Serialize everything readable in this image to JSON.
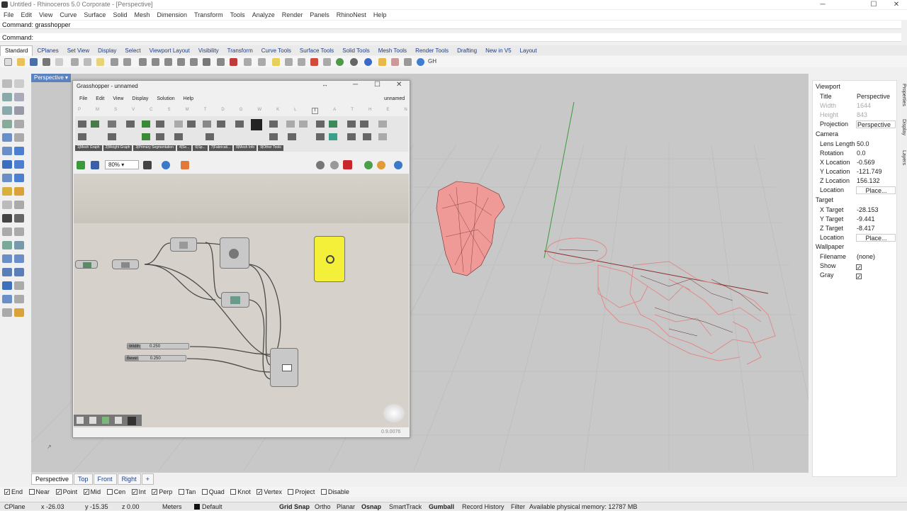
{
  "app": {
    "title": "Untitled - Rhinoceros 5.0 Corporate - [Perspective]"
  },
  "menu": [
    "File",
    "Edit",
    "View",
    "Curve",
    "Surface",
    "Solid",
    "Mesh",
    "Dimension",
    "Transform",
    "Tools",
    "Analyze",
    "Render",
    "Panels",
    "RhinoNest",
    "Help"
  ],
  "command": {
    "history": "Command: grasshopper",
    "prompt": "Command:"
  },
  "toolbar_tabs": [
    "Standard",
    "CPlanes",
    "Set View",
    "Display",
    "Select",
    "Viewport Layout",
    "Visibility",
    "Transform",
    "Curve Tools",
    "Surface Tools",
    "Solid Tools",
    "Mesh Tools",
    "Render Tools",
    "Drafting",
    "New in V5",
    "Layout"
  ],
  "viewport": {
    "label": "Perspective",
    "tabs": [
      "Perspective",
      "Top",
      "Front",
      "Right"
    ]
  },
  "osnap": [
    {
      "label": "End",
      "on": true
    },
    {
      "label": "Near",
      "on": false
    },
    {
      "label": "Point",
      "on": true
    },
    {
      "label": "Mid",
      "on": true
    },
    {
      "label": "Cen",
      "on": false
    },
    {
      "label": "Int",
      "on": true
    },
    {
      "label": "Perp",
      "on": true
    },
    {
      "label": "Tan",
      "on": false
    },
    {
      "label": "Quad",
      "on": false
    },
    {
      "label": "Knot",
      "on": false
    },
    {
      "label": "Vertex",
      "on": true
    },
    {
      "label": "Project",
      "on": false
    },
    {
      "label": "Disable",
      "on": false
    }
  ],
  "status": {
    "cplane": "CPlane",
    "x": "x -26.03",
    "y": "y -15.35",
    "z": "z 0.00",
    "units": "Meters",
    "layer": "Default",
    "grid_snap": "Grid Snap",
    "ortho": "Ortho",
    "planar": "Planar",
    "osnap": "Osnap",
    "smarttrack": "SmartTrack",
    "gumball": "Gumball",
    "record": "Record History",
    "filter": "Filter",
    "memory": "Available physical memory: 12787 MB"
  },
  "properties": {
    "header": "Viewport",
    "title_label": "Title",
    "title_value": "Perspective",
    "width_label": "Width",
    "width_value": "1644",
    "height_label": "Height",
    "height_value": "843",
    "projection_label": "Projection",
    "projection_value": "Perspective",
    "camera_header": "Camera",
    "lens_label": "Lens Length",
    "lens_value": "50.0",
    "rotation_label": "Rotation",
    "rotation_value": "0.0",
    "xloc_label": "X Location",
    "xloc_value": "-0.569",
    "yloc_label": "Y Location",
    "yloc_value": "-121.749",
    "zloc_label": "Z Location",
    "zloc_value": "156.132",
    "location_label": "Location",
    "place_label": "Place...",
    "target_header": "Target",
    "xt_label": "X Target",
    "xt_value": "-28.153",
    "yt_label": "Y Target",
    "yt_value": "-9.441",
    "zt_label": "Z Target",
    "zt_value": "-8.417",
    "tlocation_label": "Location",
    "tplace_label": "Place...",
    "wallpaper_header": "Wallpaper",
    "filename_label": "Filename",
    "filename_value": "(none)",
    "show_label": "Show",
    "gray_label": "Gray"
  },
  "side_tabs": [
    "Properties",
    "Display",
    "Layers"
  ],
  "grasshopper": {
    "title": "Grasshopper - unnamed",
    "menu": [
      "File",
      "Edit",
      "View",
      "Display",
      "Solution",
      "Help"
    ],
    "doc_name": "unnamed",
    "tab_letters": [
      "P",
      "M",
      "S",
      "V",
      "C",
      "S",
      "M",
      "T",
      "D",
      "G",
      "W",
      "K",
      "L",
      "I",
      "A",
      "T",
      "H",
      "E",
      "N"
    ],
    "ribbon_groups": [
      "1|Mesh Graph",
      "2|Weight Graph",
      "3|Primary Segmentation",
      "4|Se...",
      "6|Sp...",
      "7|Fabricati...",
      "8|Mesh Info",
      "9|Other Tools"
    ],
    "zoom": "80%",
    "slider_width_label": "Width",
    "slider_width_value": "0.250",
    "slider_bevel_label": "Bevel",
    "slider_bevel_value": "0.250",
    "version": "0.9.0076"
  }
}
